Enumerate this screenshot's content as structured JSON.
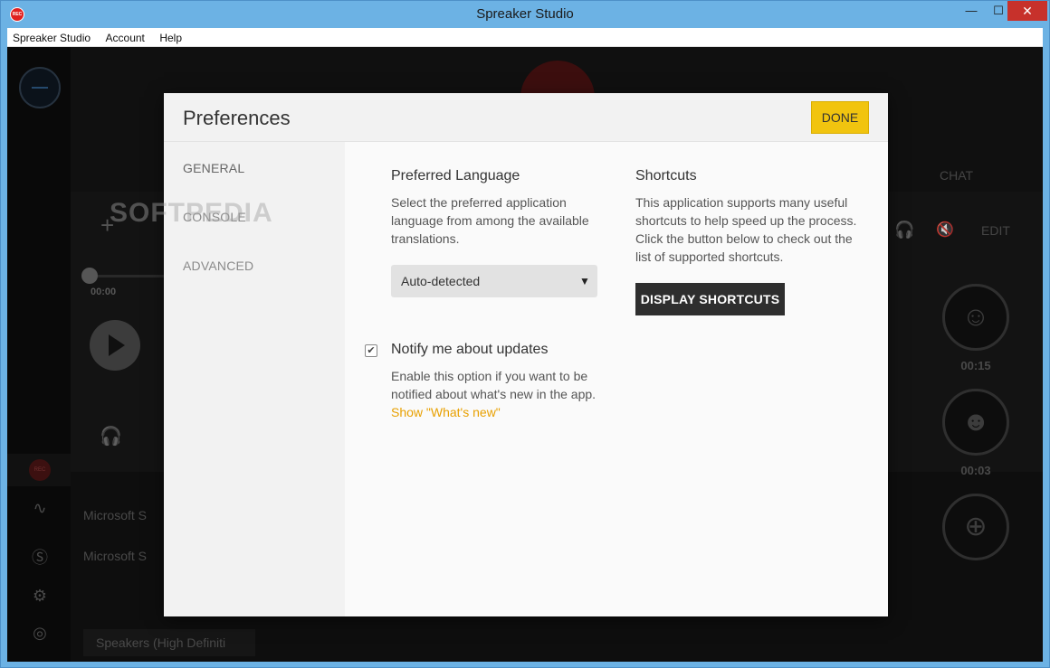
{
  "window": {
    "title": "Spreaker Studio",
    "app_logo_text": "REC",
    "minimize_glyph": "—",
    "maximize_glyph": "☐",
    "close_glyph": "✕"
  },
  "menubar": {
    "items": [
      "Spreaker Studio",
      "Account",
      "Help"
    ]
  },
  "background_app": {
    "time_start": "00:00",
    "mic_list": [
      "Microsoft S",
      "Microsoft S"
    ],
    "speakers_select": "Speakers (High Definiti",
    "chat_tab": "CHAT",
    "edit_tab": "EDIT",
    "jingles": [
      {
        "time": "00:15"
      },
      {
        "time": "00:03"
      }
    ]
  },
  "dialog": {
    "title": "Preferences",
    "done_label": "DONE",
    "nav": [
      "GENERAL",
      "CONSOLE",
      "ADVANCED"
    ],
    "watermark": "SOFTPEDIA",
    "language": {
      "title": "Preferred Language",
      "description": "Select the preferred application language from among the available translations.",
      "selected": "Auto-detected"
    },
    "notify": {
      "title": "Notify me about updates",
      "checked": true,
      "description": "Enable this option if you want to be notified about what's new in the app.",
      "link": "Show \"What's new\""
    },
    "shortcuts": {
      "title": "Shortcuts",
      "description": "This application supports many useful shortcuts to help speed up the process. Click the button below to check out the list of supported shortcuts.",
      "button_label": "DISPLAY SHORTCUTS"
    }
  },
  "colors": {
    "accent_yellow": "#f1c40f",
    "link_orange": "#e8a000",
    "titlebar_blue": "#6cb2e4",
    "close_red": "#c7312b"
  }
}
